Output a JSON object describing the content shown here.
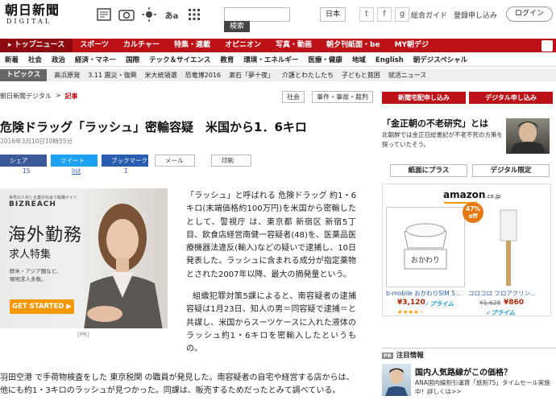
{
  "header": {
    "logo_line1": "朝日新聞",
    "logo_line2": "DIGITAL",
    "search_button": "検索",
    "edition": "日本",
    "links": [
      "総合ガイド",
      "登録申し込み"
    ],
    "login": "ログイン"
  },
  "main_nav": [
    "トップニュース",
    "スポーツ",
    "カルチャー",
    "特集・連載",
    "オピニオン",
    "写真・動画",
    "朝夕刊紙面・be",
    "MY朝デジ"
  ],
  "sub_nav": [
    "新着",
    "社会",
    "政治",
    "経済・マネー",
    "国際",
    "テック＆サイエンス",
    "教育",
    "環境・エネルギー",
    "医療・健康",
    "地域",
    "English",
    "朝デジスペシャル"
  ],
  "topics": {
    "label": "トピックス",
    "items": [
      "高浜原発",
      "3.11 震災・復興",
      "米大統領選",
      "恐竜博2016",
      "漱石「夢十夜」",
      "介護とわたしたち",
      "子どもと貧困",
      "就活ニュース"
    ]
  },
  "breadcrumb": {
    "home": "朝日新聞デジタル",
    "sep": ">",
    "current": "記事"
  },
  "tags": [
    "社会",
    "事件・事故・裁判"
  ],
  "promo_buttons": [
    "新聞宅配申し込み",
    "デジタル申し込み"
  ],
  "article": {
    "title": "危険ドラッグ「ラッシュ」密輸容疑　米国から1．6キロ",
    "date": "2016年3月10日10時55分",
    "share": [
      {
        "label": "シェア",
        "count": "15"
      },
      {
        "label": "ツイート",
        "count": "list"
      },
      {
        "label": "ブックマーク",
        "count": "1"
      },
      {
        "label": "メール",
        "count": ""
      },
      {
        "label": "印刷",
        "count": ""
      }
    ],
    "para1": "「ラッシュ」と呼ばれる 危険ドラッグ 約1・6キロ(末端価格約100万円)を米国から密輸したとして、警視庁 は、東京都 新宿区 新宿5丁目、飲食店経営南健一容疑者(48)を、医薬品医療機器法違反(輸入)などの疑いで逮捕し、10日発表した。ラッシュに含まれる成分が指定薬物とされた2007年以降、最大の摘発量という。",
    "para2": "組織犯罪対策5課によると、南容疑者の逮捕容疑は1月23日、知人の男＝同容疑で逮捕＝と共謀し、米国からスーツケースに入れた液体のラッシュ約1・6キロを密輸入したというもの。",
    "para3": "羽田空港 で手荷物検査をした 東京税関 の職員が発見した。南容疑者の自宅や経営する店からは、他にも約1・3キロのラッシュが見つかった。同課は、販売するためだったとみて調べている。"
  },
  "ad": {
    "tagline": "世界の人材と企業が出会う転職サイト",
    "brand": "BIZREACH",
    "headline": "海外勤務",
    "sub": "求人特集",
    "body": "欧米・アジア圏など、現地求人多数。",
    "cta": "GET STARTED ▶",
    "label": "[PR]"
  },
  "sidebar": {
    "feature_title": "「金正朝の不老研究」とは",
    "feature_text": "北朝鮮では金正日総書記が不老不死の方策を探っていたそう。",
    "btn_paper": "紙面にプラス",
    "btn_digital": "デジタル限定",
    "amazon": {
      "logo": "amazon",
      "logo_suffix": ".co.jp",
      "badge": "47% off",
      "product1": {
        "name": "b-mobile おかわりSIM 5...",
        "price": "¥3,120",
        "prime": "✓プライム"
      },
      "product2": {
        "name": "コロコロ フロアクリン...",
        "old_price": "¥1,628",
        "price": "¥860",
        "prime": "✓プライム"
      },
      "rating": "★★★★☆"
    },
    "notice_label": "PR",
    "notice_title_header": "注目情報",
    "notice_title": "国内人気路線がこの価格？",
    "notice_text": "ANA国内線割引運賃「旅割75」タイムセール実施中！詳しくは>>"
  },
  "colors": {
    "brand_red": "#bd1118",
    "amazon_orange": "#f39800"
  }
}
